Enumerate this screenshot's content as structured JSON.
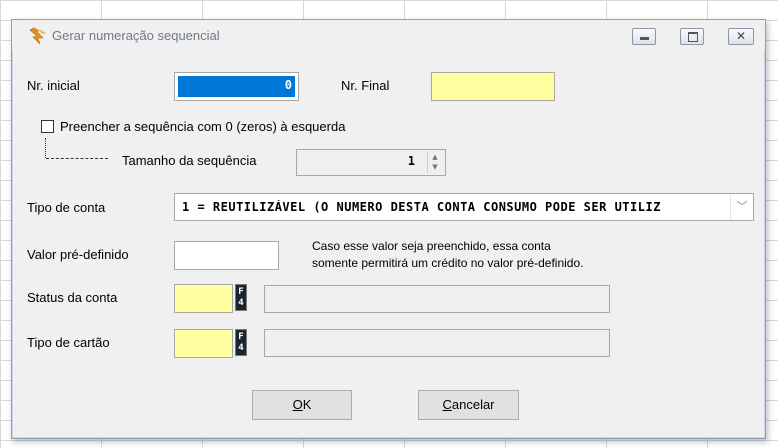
{
  "window": {
    "title": "Gerar numeração sequencial",
    "icon": "lightning-bird-icon",
    "close_glyph": "✕"
  },
  "form": {
    "nr_inicial_label": "Nr. inicial",
    "nr_inicial_value": "0",
    "nr_final_label": "Nr. Final",
    "nr_final_value": "",
    "fill_zeros_label": "Preencher a sequência com 0 (zeros) à esquerda",
    "fill_zeros_checked": false,
    "tamanho_label": "Tamanho da sequência",
    "tamanho_value": "1",
    "tipo_conta_label": "Tipo de conta",
    "tipo_conta_value": "1 = REUTILIZÁVEL (O NUMERO DESTA CONTA CONSUMO PODE SER UTILIZ",
    "valor_label": "Valor pré-definido",
    "valor_value": "",
    "valor_hint_line1": "Caso esse valor seja preenchido, essa conta",
    "valor_hint_line2": "somente permitirá um crédito no valor pré-definido.",
    "status_label": "Status da conta",
    "status_code": "",
    "status_desc": "",
    "cartao_label": "Tipo de cartão",
    "cartao_code": "",
    "cartao_desc": "",
    "f4_label_1": "F",
    "f4_label_2": "4"
  },
  "buttons": {
    "ok_accel": "O",
    "ok_rest": "K",
    "cancel_accel": "C",
    "cancel_rest": "ancelar"
  },
  "colors": {
    "yellow_field": "#ffffa0",
    "selection": "#0078d7",
    "dialog_bg": "#f0f0f0"
  }
}
